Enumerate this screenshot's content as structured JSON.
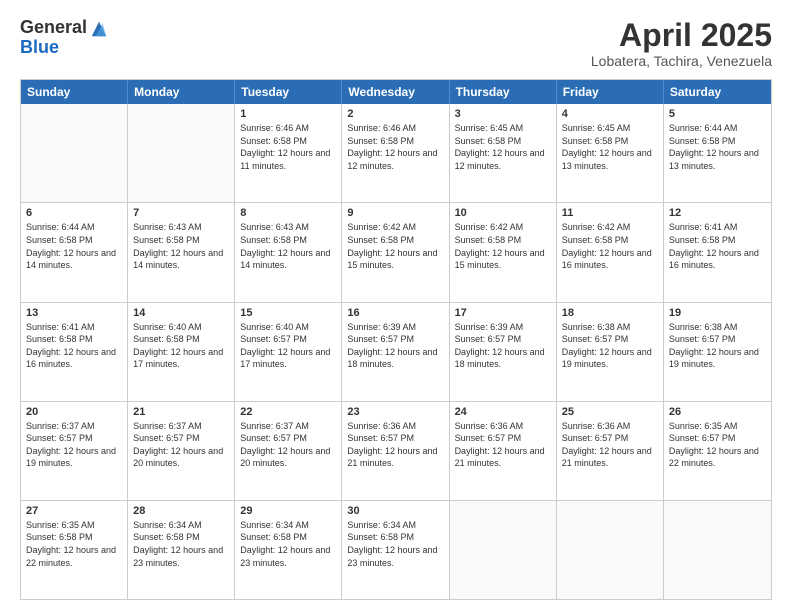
{
  "header": {
    "logo_general": "General",
    "logo_blue": "Blue",
    "month_title": "April 2025",
    "location": "Lobatera, Tachira, Venezuela"
  },
  "weekdays": [
    "Sunday",
    "Monday",
    "Tuesday",
    "Wednesday",
    "Thursday",
    "Friday",
    "Saturday"
  ],
  "rows": [
    [
      {
        "day": "",
        "info": ""
      },
      {
        "day": "",
        "info": ""
      },
      {
        "day": "1",
        "info": "Sunrise: 6:46 AM\nSunset: 6:58 PM\nDaylight: 12 hours and 11 minutes."
      },
      {
        "day": "2",
        "info": "Sunrise: 6:46 AM\nSunset: 6:58 PM\nDaylight: 12 hours and 12 minutes."
      },
      {
        "day": "3",
        "info": "Sunrise: 6:45 AM\nSunset: 6:58 PM\nDaylight: 12 hours and 12 minutes."
      },
      {
        "day": "4",
        "info": "Sunrise: 6:45 AM\nSunset: 6:58 PM\nDaylight: 12 hours and 13 minutes."
      },
      {
        "day": "5",
        "info": "Sunrise: 6:44 AM\nSunset: 6:58 PM\nDaylight: 12 hours and 13 minutes."
      }
    ],
    [
      {
        "day": "6",
        "info": "Sunrise: 6:44 AM\nSunset: 6:58 PM\nDaylight: 12 hours and 14 minutes."
      },
      {
        "day": "7",
        "info": "Sunrise: 6:43 AM\nSunset: 6:58 PM\nDaylight: 12 hours and 14 minutes."
      },
      {
        "day": "8",
        "info": "Sunrise: 6:43 AM\nSunset: 6:58 PM\nDaylight: 12 hours and 14 minutes."
      },
      {
        "day": "9",
        "info": "Sunrise: 6:42 AM\nSunset: 6:58 PM\nDaylight: 12 hours and 15 minutes."
      },
      {
        "day": "10",
        "info": "Sunrise: 6:42 AM\nSunset: 6:58 PM\nDaylight: 12 hours and 15 minutes."
      },
      {
        "day": "11",
        "info": "Sunrise: 6:42 AM\nSunset: 6:58 PM\nDaylight: 12 hours and 16 minutes."
      },
      {
        "day": "12",
        "info": "Sunrise: 6:41 AM\nSunset: 6:58 PM\nDaylight: 12 hours and 16 minutes."
      }
    ],
    [
      {
        "day": "13",
        "info": "Sunrise: 6:41 AM\nSunset: 6:58 PM\nDaylight: 12 hours and 16 minutes."
      },
      {
        "day": "14",
        "info": "Sunrise: 6:40 AM\nSunset: 6:58 PM\nDaylight: 12 hours and 17 minutes."
      },
      {
        "day": "15",
        "info": "Sunrise: 6:40 AM\nSunset: 6:57 PM\nDaylight: 12 hours and 17 minutes."
      },
      {
        "day": "16",
        "info": "Sunrise: 6:39 AM\nSunset: 6:57 PM\nDaylight: 12 hours and 18 minutes."
      },
      {
        "day": "17",
        "info": "Sunrise: 6:39 AM\nSunset: 6:57 PM\nDaylight: 12 hours and 18 minutes."
      },
      {
        "day": "18",
        "info": "Sunrise: 6:38 AM\nSunset: 6:57 PM\nDaylight: 12 hours and 19 minutes."
      },
      {
        "day": "19",
        "info": "Sunrise: 6:38 AM\nSunset: 6:57 PM\nDaylight: 12 hours and 19 minutes."
      }
    ],
    [
      {
        "day": "20",
        "info": "Sunrise: 6:37 AM\nSunset: 6:57 PM\nDaylight: 12 hours and 19 minutes."
      },
      {
        "day": "21",
        "info": "Sunrise: 6:37 AM\nSunset: 6:57 PM\nDaylight: 12 hours and 20 minutes."
      },
      {
        "day": "22",
        "info": "Sunrise: 6:37 AM\nSunset: 6:57 PM\nDaylight: 12 hours and 20 minutes."
      },
      {
        "day": "23",
        "info": "Sunrise: 6:36 AM\nSunset: 6:57 PM\nDaylight: 12 hours and 21 minutes."
      },
      {
        "day": "24",
        "info": "Sunrise: 6:36 AM\nSunset: 6:57 PM\nDaylight: 12 hours and 21 minutes."
      },
      {
        "day": "25",
        "info": "Sunrise: 6:36 AM\nSunset: 6:57 PM\nDaylight: 12 hours and 21 minutes."
      },
      {
        "day": "26",
        "info": "Sunrise: 6:35 AM\nSunset: 6:57 PM\nDaylight: 12 hours and 22 minutes."
      }
    ],
    [
      {
        "day": "27",
        "info": "Sunrise: 6:35 AM\nSunset: 6:58 PM\nDaylight: 12 hours and 22 minutes."
      },
      {
        "day": "28",
        "info": "Sunrise: 6:34 AM\nSunset: 6:58 PM\nDaylight: 12 hours and 23 minutes."
      },
      {
        "day": "29",
        "info": "Sunrise: 6:34 AM\nSunset: 6:58 PM\nDaylight: 12 hours and 23 minutes."
      },
      {
        "day": "30",
        "info": "Sunrise: 6:34 AM\nSunset: 6:58 PM\nDaylight: 12 hours and 23 minutes."
      },
      {
        "day": "",
        "info": ""
      },
      {
        "day": "",
        "info": ""
      },
      {
        "day": "",
        "info": ""
      }
    ]
  ]
}
